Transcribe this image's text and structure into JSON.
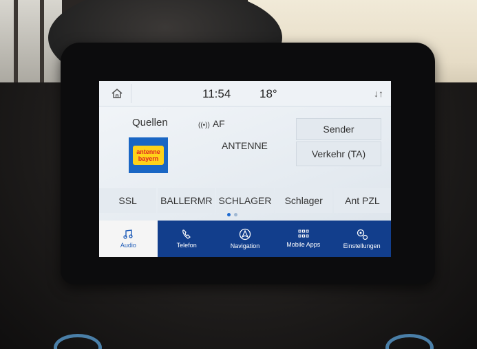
{
  "status_bar": {
    "time": "11:54",
    "temperature": "18°"
  },
  "audio": {
    "sources_label": "Quellen",
    "af_label": "AF",
    "station_name": "ANTENNE",
    "logo_line1": "antenne",
    "logo_line2": "bayern",
    "sender_button": "Sender",
    "traffic_button": "Verkehr (TA)"
  },
  "presets": [
    "SSL",
    "BALLERMR",
    "SCHLAGER",
    "Schlager",
    "Ant PZL"
  ],
  "page_indicator": {
    "pages": 2,
    "current": 1
  },
  "nav": {
    "items": [
      {
        "label": "Audio",
        "icon": "music-note-icon",
        "active": true
      },
      {
        "label": "Telefon",
        "icon": "phone-icon",
        "active": false
      },
      {
        "label": "Navigation",
        "icon": "navigation-arrow-icon",
        "active": false
      },
      {
        "label": "Mobile Apps",
        "icon": "app-grid-icon",
        "active": false
      },
      {
        "label": "Einstellungen",
        "icon": "gears-icon",
        "active": false
      }
    ]
  },
  "colors": {
    "accent_blue": "#1d6ad0",
    "nav_bar": "#123e8c",
    "screen_bg": "#eef2f6"
  }
}
